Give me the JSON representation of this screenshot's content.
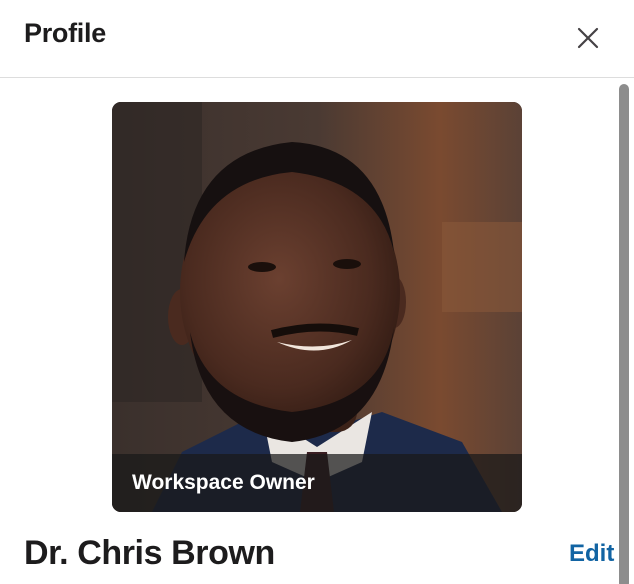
{
  "header": {
    "title": "Profile",
    "close_icon": "close-icon"
  },
  "profile": {
    "photo_badge": "Workspace Owner",
    "name": "Dr. Chris Brown",
    "edit_label": "Edit"
  },
  "colors": {
    "link": "#1264a3",
    "text": "#1d1c1d",
    "divider": "#dddddd",
    "scrollbar": "#8d8d8d"
  }
}
